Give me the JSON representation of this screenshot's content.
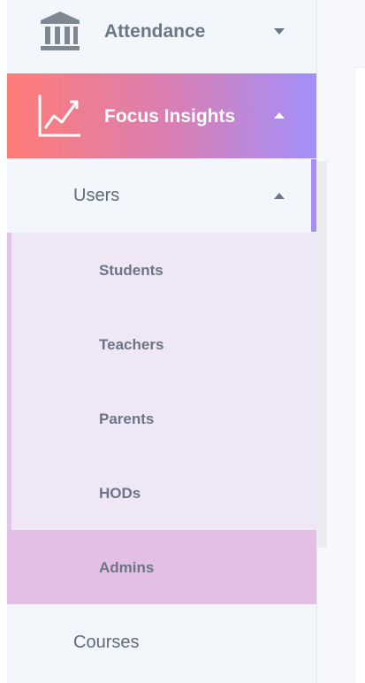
{
  "sidebar": {
    "items": [
      {
        "label": "Attendance",
        "icon": "bank-icon",
        "state": "collapsed"
      },
      {
        "label": "Focus Insights",
        "icon": "trending-up-chart-icon",
        "state": "expanded",
        "active": true
      }
    ],
    "focus_insights": {
      "groups": [
        {
          "label": "Users",
          "state": "expanded",
          "items": [
            {
              "label": "Students"
            },
            {
              "label": "Teachers"
            },
            {
              "label": "Parents"
            },
            {
              "label": "HODs"
            },
            {
              "label": "Admins",
              "selected": true
            }
          ]
        },
        {
          "label": "Courses",
          "state": "collapsed"
        }
      ]
    }
  },
  "colors": {
    "active_gradient_start": "#ff7c76",
    "active_gradient_end": "#a290fb",
    "submenu_bg": "#efe6f6",
    "selected_bg": "#e3bfe6",
    "text_muted": "#6b7686"
  }
}
